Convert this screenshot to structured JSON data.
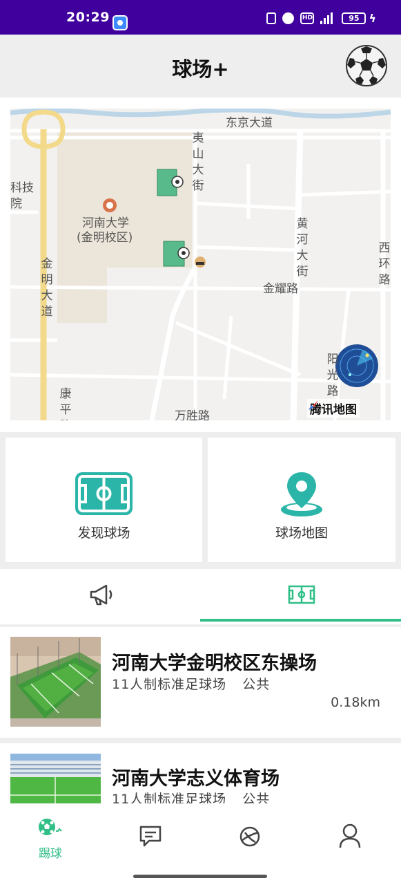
{
  "status_bar": {
    "time": "20:29",
    "hd": "HD",
    "battery": "95",
    "icons": [
      "app-notification-icon",
      "nfc-icon",
      "alarm-icon",
      "hd-icon",
      "signal-icon",
      "battery-icon",
      "charging-icon"
    ]
  },
  "header": {
    "title": "球场+",
    "avatar_icon": "soccer-ball-icon"
  },
  "map": {
    "labels": {
      "dongjing": "东京大道",
      "yishan": "夷山大街",
      "keji": "科技院",
      "henan_uni": "河南大学",
      "campus": "(金明校区)",
      "jinming": "金明大道",
      "huanghe": "黄河大街",
      "xihuan": "西环路",
      "jinyao": "金耀路",
      "yangguang": "阳光路",
      "kangping": "康平路",
      "wansheng": "万胜路"
    },
    "provider": "腾讯地图"
  },
  "features": [
    {
      "label": "发现球场",
      "icon": "soccer-field-icon"
    },
    {
      "label": "球场地图",
      "icon": "location-pin-icon"
    }
  ],
  "tabs": [
    {
      "icon": "megaphone-icon",
      "active": false
    },
    {
      "icon": "field-icon",
      "active": true
    }
  ],
  "venues": [
    {
      "name": "河南大学金明校区东操场",
      "desc": "11人制标准足球场",
      "access": "公共",
      "distance": "0.18km"
    },
    {
      "name": "河南大学志义体育场",
      "desc": "11人制标准足球场",
      "access": "公共",
      "distance": ""
    }
  ],
  "bottom_nav": [
    {
      "label": "踢球",
      "icon": "soccer-ball-icon",
      "active": true
    },
    {
      "label": "",
      "icon": "message-icon",
      "active": false
    },
    {
      "label": "",
      "icon": "planet-icon",
      "active": false
    },
    {
      "label": "",
      "icon": "profile-icon",
      "active": false
    }
  ],
  "colors": {
    "status_bar": "#3f009e",
    "accent": "#2fbf87",
    "teal_icon": "#2bb5a8"
  }
}
